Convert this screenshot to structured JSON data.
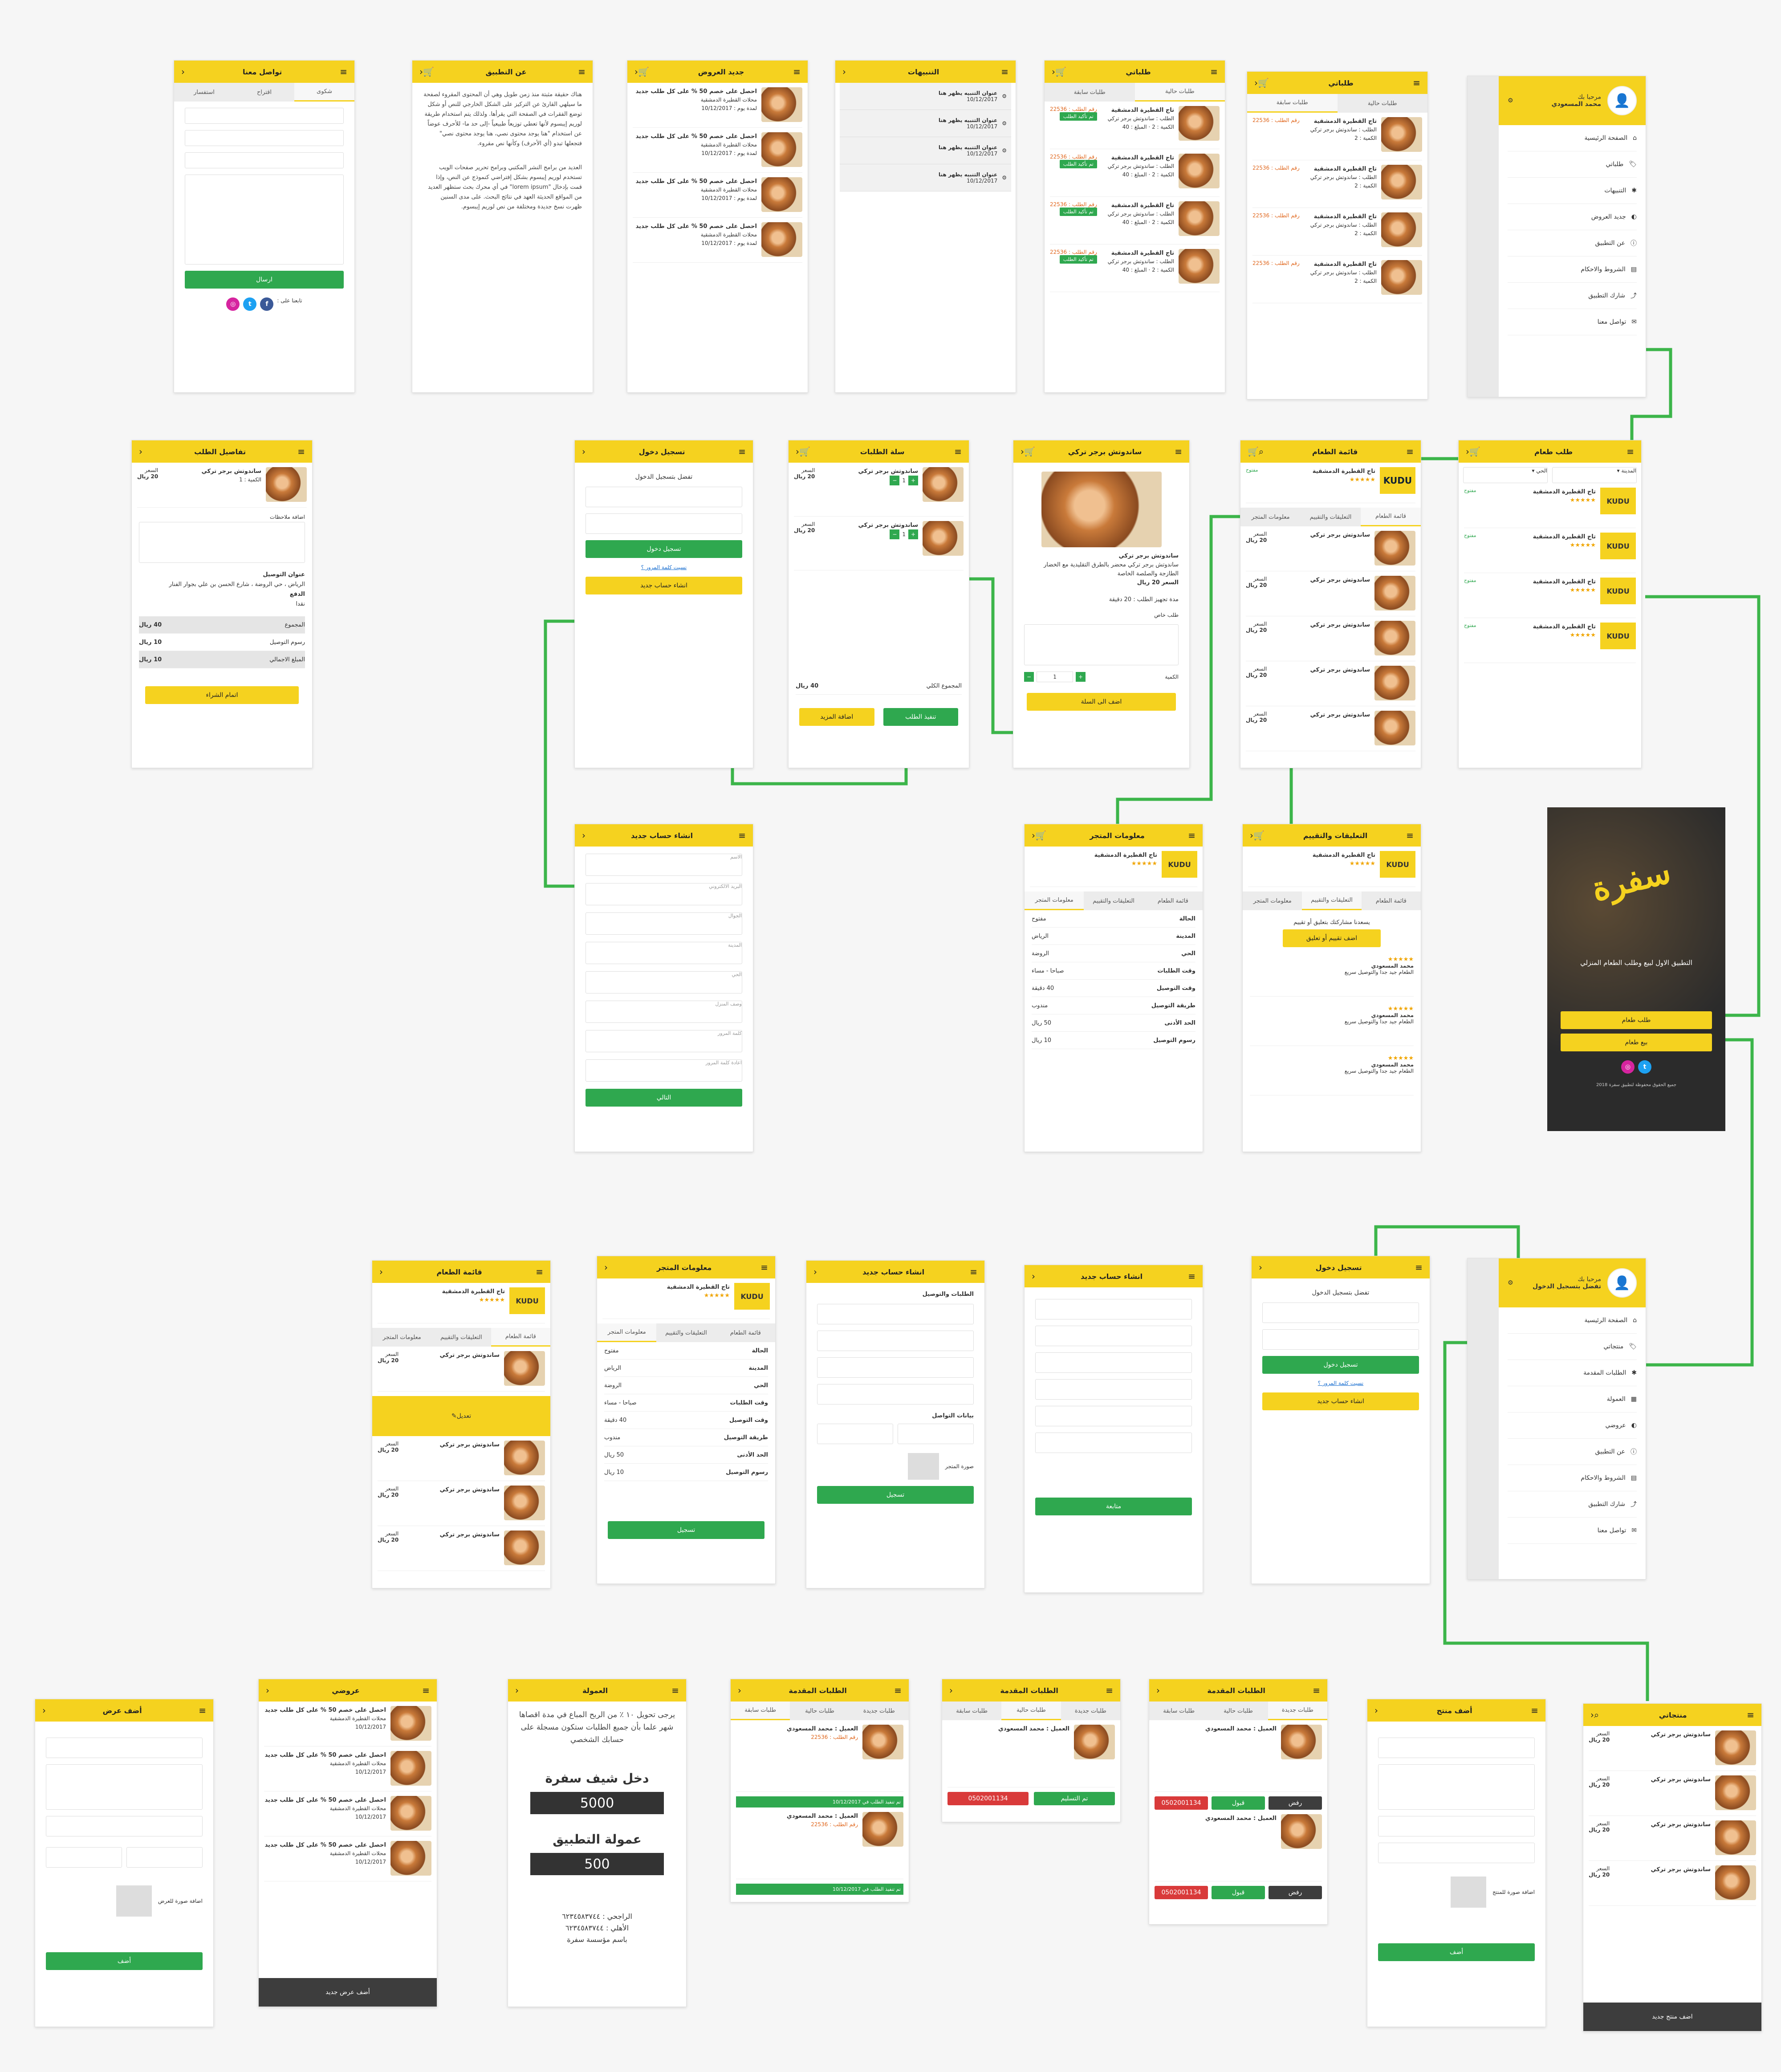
{
  "icons": {
    "menu": "≡",
    "back": "‹",
    "cart": "🛒",
    "search": "⌕",
    "gear": "⚙",
    "user": "👤"
  },
  "colors": {
    "accent": "#f5d21f",
    "green": "#2fa84f",
    "connector": "#3cb54a",
    "dark": "#3d3d3d"
  },
  "screens": {
    "contact": {
      "title": "تواصل معنا",
      "tabs": [
        "شكوى",
        "اقتراح",
        "استفسار"
      ],
      "send": "ارسال",
      "follow": "تابعنا على :"
    },
    "about": {
      "title": "عن التطبيق",
      "text": "هناك حقيقة مثبتة منذ زمن طويل وهي أن المحتوى المقروء لصفحة ما سيلهي القارئ عن التركيز على الشكل الخارجي للنص أو شكل توضع الفقرات في الصفحة التي يقرأها. ولذلك يتم استخدام طريقة لوريم إيبسوم لأنها تعطي توزيعاً طبيعياً -إلى حد ما- للأحرف عوضاً عن استخدام \"هنا يوجد محتوى نصي، هنا يوجد محتوى نصي\" فتجعلها تبدو (أي الأحرف) وكأنها نص مقروء.",
      "text2": "العديد من برامح النشر المكتبي وبرامح تحرير صفحات الويب تستخدم لوريم إيبسوم بشكل إفتراضي كنموذج عن النص، وإذا قمت بإدخال \"lorem ipsum\" في أي محرك بحث ستظهر العديد من المواقع الحديثة العهد في نتائج البحث. على مدى السنين ظهرت نسخ جديدة ومختلفة من نص لوريم إيبسوم."
    },
    "offers": {
      "title": "جديد العروض",
      "item": "احصل على خصم 50 % على كل طلب جديد",
      "shop": "محلات القطيرة الدمشقية",
      "date": "لمدة يوم : 10/12/2017"
    },
    "notifications": {
      "title": "التنبيهات",
      "item": "عنوان التنبيه يظهر هنا",
      "date": "10/12/2017"
    },
    "orders1": {
      "title": "طلباتي",
      "tabs": [
        "طلبات حالية",
        "طلبات سابقة"
      ],
      "shop": "تاج القطيرة الدمشقية",
      "desc": "الطلب : ساندوتش برجر تركي",
      "qty": "الكمية : 2",
      "total": "المبلغ : 40",
      "order_no": "رقم الطلب : 22536",
      "btn": "تم تأكيد الطلب"
    },
    "orders2": {
      "title": "طلباتي",
      "tabs": [
        "طلبات حالية",
        "طلبات سابقة"
      ],
      "shop": "تاج القطيرة الدمشقية",
      "desc": "الطلب : ساندوتش برجر تركي",
      "qty": "الكمية : 2",
      "total": "المبلغ : 40",
      "order_no": "رقم الطلب : 22536"
    },
    "menu1": {
      "greeting": "مرحبا بك",
      "name": "محمد المسعودي",
      "items": [
        "الصفحة الرئيسية",
        "طلباتي",
        "التنبيهات",
        "جديد العروض",
        "عن التطبيق",
        "الشروط والاحكام",
        "شارك التطبيق",
        "تواصل معنا"
      ]
    },
    "order_details": {
      "title": "تفاصيل الطلب",
      "product": "ساندوتش برجر تركي",
      "qty": "الكمية : 1",
      "price_label": "السعر",
      "price": "20 ريال",
      "notes": "اضافة ملاحظات",
      "address_label": "عنوان التوصيل",
      "address": "الرياض ، حي الروضة ، شارع الحسن بن علي بجوار الفنار",
      "pay_label": "الدفع",
      "pay": "نقدا",
      "sum_label": "المجموع",
      "sum": "40 ريال",
      "fee_label": "رسوم التوصيل",
      "fee": "10 ريال",
      "grand_label": "المبلغ الاجمالي",
      "grand": "10 ريال",
      "confirm": "اتمام الشراء"
    },
    "login1": {
      "title": "تسجيل دخول",
      "prompt": "تفضل بتسجيل الدخول",
      "email": "البريد الالكتروني",
      "password": "كلمة المرور",
      "login": "تسجيل دخول",
      "forgot": "نسيت كلمة المرور ؟",
      "create": "انشاء حساب جديد"
    },
    "cart": {
      "title": "سلة الطلبات",
      "product": "ساندوتش برجر تركي",
      "price_label": "السعر",
      "price": "20 ريال",
      "qty_label": "الكمية",
      "total_label": "الاجمالي",
      "sum_label": "المجموع الكلي",
      "sum": "40 ريال",
      "checkout": "تنفيذ الطلب",
      "more": "اضافة المزيد"
    },
    "product": {
      "title": "ساندوتش برجر تركي",
      "name": "ساندوتش برجر تركي",
      "desc": "ساندوتش برجر تركي محضر بالطرق التقليدية مع الخضار الطازجة والصلصة الخاصة",
      "price_label": "السعر",
      "price": "20 ريال",
      "prep": "مدة تجهيز الطلب : 20 دقيقة",
      "special": "طلب خاص",
      "qty_label": "الكمية",
      "qty": "1",
      "add": "اضف الى السلة"
    },
    "food_menu": {
      "title": "قائمة الطعام",
      "shop": "تاج القطيرة الدمشقية",
      "status": "مفتوح",
      "tabs": [
        "قائمة الطعام",
        "التعليقات والتقييم",
        "معلومات المتجر"
      ],
      "product": "ساندوتش برجر تركي",
      "price_label": "السعر",
      "price": "20 ريال"
    },
    "order_food": {
      "title": "طلب طعام",
      "city": "المدينة",
      "district": "الحي",
      "shop": "تاج القطيرة الدمشقية",
      "status": "مفتوح"
    },
    "register1": {
      "title": "انشاء حساب جديد",
      "fields": [
        "الاسم",
        "البريد الالكتروني",
        "الجوال",
        "المدينة",
        "الحي",
        "وصف المنزل",
        "كلمة المرور",
        "اعادة كلمة المرور"
      ],
      "submit": "التالي"
    },
    "store_info": {
      "title": "معلومات المتجر",
      "shop": "تاج القطيرة الدمشقية",
      "tabs": [
        "قائمة الطعام",
        "التعليقات والتقييم",
        "معلومات المتجر"
      ],
      "rows": [
        "الحالة",
        "المدينة",
        "الحي",
        "وقت الطلبات",
        "وقت التوصيل",
        "طريقة التوصيل",
        "الحد الأدنى",
        "رسوم التوصيل"
      ],
      "values": [
        "مفتوح",
        "الرياض",
        "الروضة",
        "صباحا - مساء",
        "40 دقيقة",
        "مندوب",
        "50 ريال",
        "10 ريال"
      ]
    },
    "reviews": {
      "title": "التعليقات والتقييم",
      "shop": "تاج القطيرة الدمشقية",
      "tabs": [
        "قائمة الطعام",
        "التعليقات والتقييم",
        "معلومات المتجر"
      ],
      "prompt": "يسعدنا مشاركتك بتعليق أو تقييم",
      "add": "اضف تقييم أو تعليق",
      "reviewer": "محمد المسعودي",
      "comment": "الطعام جيد جدا والتوصيل سريع"
    },
    "splash": {
      "tagline": "التطبيق الاول لبيع وطلب الطعام المنزلي",
      "order": "طلب طعام",
      "sell": "بيع طعام",
      "logo": "سفرة",
      "copy": "جميع الحقوق محفوظة لتطبيق سفرة 2018"
    },
    "chef_menu": {
      "title": "قائمة الطعام",
      "shop": "تاج القطيرة الدمشقية",
      "tabs": [
        "قائمة الطعام",
        "التعليقات والتقييم",
        "معلومات المتجر"
      ],
      "product": "ساندوتش برجر تركي",
      "price_label": "السعر",
      "price": "20 ريال",
      "edit": "تعديل"
    },
    "chef_store": {
      "title": "معلومات المتجر",
      "shop": "تاج القطيرة الدمشقية",
      "save": "تسجيل"
    },
    "chef_register2": {
      "title": "انشاء حساب جديد",
      "section": "الطلبات والتوصيل",
      "contact": "بيانات التواصل",
      "photo": "صورة المتجر",
      "submit": "تسجيل"
    },
    "chef_register1": {
      "title": "انشاء حساب جديد",
      "submit": "متابعة"
    },
    "login2": {
      "title": "تسجيل دخول",
      "prompt": "تفضل بتسجيل الدخول",
      "login": "تسجيل دخول",
      "forgot": "نسيت كلمة المرور ؟",
      "create": "انشاء حساب جديد"
    },
    "menu2": {
      "greeting": "مرحبا بك",
      "sub": "تفضل بتسجيل الدخول",
      "items": [
        "الصفحة الرئيسية",
        "منتجاتي",
        "الطلبات المقدمة",
        "العمولة",
        "عروضي",
        "عن التطبيق",
        "الشروط والاحكام",
        "شارك التطبيق",
        "تواصل معنا"
      ]
    },
    "add_offer": {
      "title": "أضف عرض",
      "photo": "اضافة صورة للعرض",
      "submit": "أضف"
    },
    "my_offers": {
      "title": "عروضي",
      "item": "احصل على خصم 50 % على كل طلب جديد",
      "shop": "محلات القطيرة الدمشقية",
      "date": "10/12/2017",
      "add": "أضف عرض جديد"
    },
    "commission": {
      "title": "العمولة",
      "text": "يرجى تحويل ١٠ ٪ من الربح المباع في مدة اقصاها شهر علما بأن جميع الطلبات ستكون مسجلة على حسابك الشخصي",
      "income_label": "دخل شيف سفرة",
      "income": "5000",
      "fee_label": "عمولة التطبيق",
      "fee": "500",
      "bank": "الراجحي : ٦٢٣٤٥٨٣٧٤٤\nالأهلي : ٦٢٣٤٥٨٣٧٤٤\nباسم مؤسسة سفرة"
    },
    "submitted1": {
      "title": "الطلبات المقدمة",
      "tabs": [
        "طلبات جديدة",
        "طلبات حالية",
        "طلبات سابقة"
      ],
      "customer": "العميل : محمد المسعودي",
      "order_no": "رقم الطلب : 22536",
      "status": "تم تنفيذ الطلب في 10/12/2017"
    },
    "submitted2": {
      "title": "الطلبات المقدمة",
      "customer": "العميل : محمد المسعودي",
      "done": "تم التسليم",
      "phone": "0502001134"
    },
    "submitted3": {
      "title": "الطلبات المقدمة",
      "customer": "العميل : محمد المسعودي",
      "reject": "رفض",
      "accept": "قبول",
      "phone": "0502001134"
    },
    "add_product": {
      "title": "أضف منتج",
      "photo": "اضافة صورة للمنتج",
      "submit": "أضف"
    },
    "my_products": {
      "title": "منتجاتي",
      "product": "ساندوتش برجر تركي",
      "price_label": "السعر",
      "price": "20 ريال",
      "add": "اضف منتج جديد"
    }
  }
}
